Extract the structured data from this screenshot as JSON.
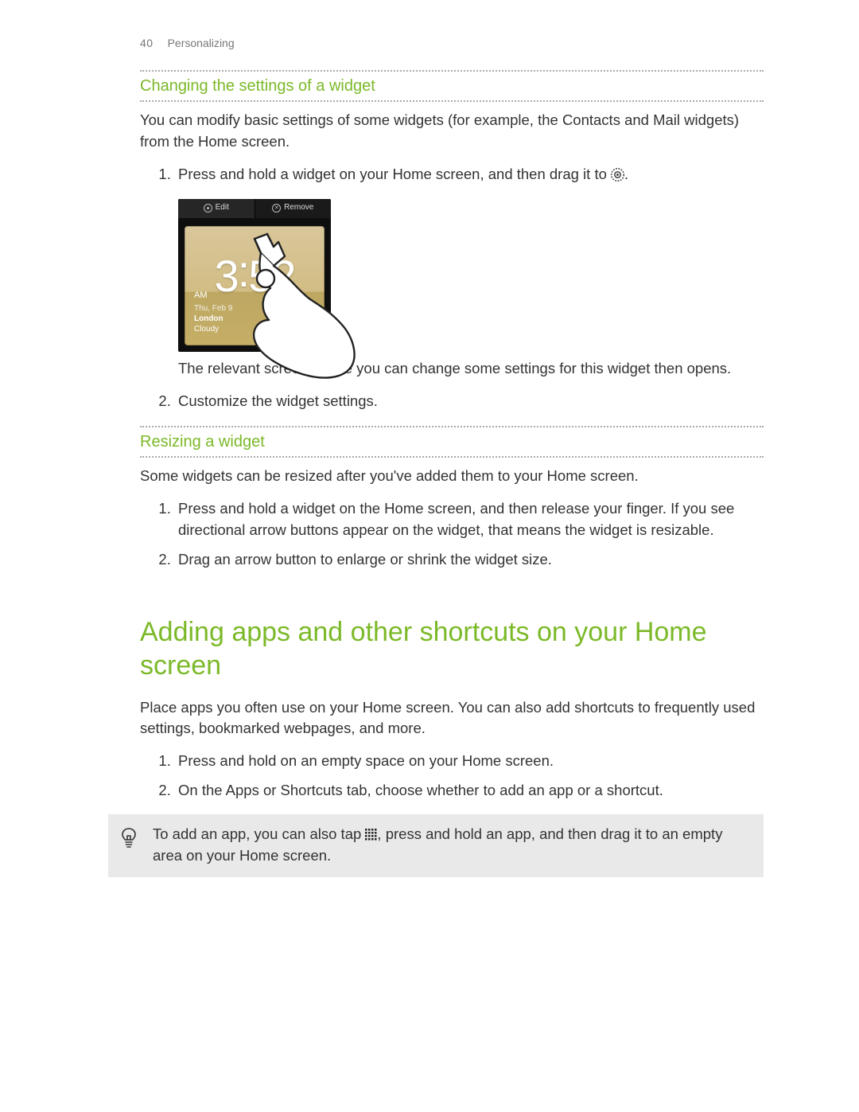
{
  "runhead": {
    "page_no": "40",
    "section": "Personalizing"
  },
  "s1": {
    "heading": "Changing the settings of a widget",
    "intro": "You can modify basic settings of some widgets (for example, the Contacts and Mail widgets) from the Home screen.",
    "step1_before": "Press and hold a widget on your Home screen, and then drag it to ",
    "step1_after": ".",
    "step1_cont": "The relevant screen where you can change some settings for this widget then opens.",
    "step2": "Customize the widget settings."
  },
  "illustration": {
    "edit_label": "Edit",
    "remove_label": "Remove",
    "hour": "3",
    "minute": "52",
    "ampm": "AM",
    "date_line": "Thu, Feb 9",
    "city_line": "London",
    "cond_line": "Cloudy"
  },
  "s2": {
    "heading": "Resizing a widget",
    "intro": "Some widgets can be resized after you've added them to your Home screen.",
    "step1": "Press and hold a widget on the Home screen, and then release your finger. If you see directional arrow buttons appear on the widget, that means the widget is resizable.",
    "step2": "Drag an arrow button to enlarge or shrink the widget size."
  },
  "s3": {
    "heading": "Adding apps and other shortcuts on your Home screen",
    "intro": "Place apps you often use on your Home screen. You can also add shortcuts to frequently used settings, bookmarked webpages, and more.",
    "step1": "Press and hold on an empty space on your Home screen.",
    "step2": "On the Apps or Shortcuts tab, choose whether to add an app or a shortcut."
  },
  "tip": {
    "before": "To add an app, you can also tap ",
    "after": ", press and hold an app, and then drag it to an empty area on your Home screen."
  }
}
